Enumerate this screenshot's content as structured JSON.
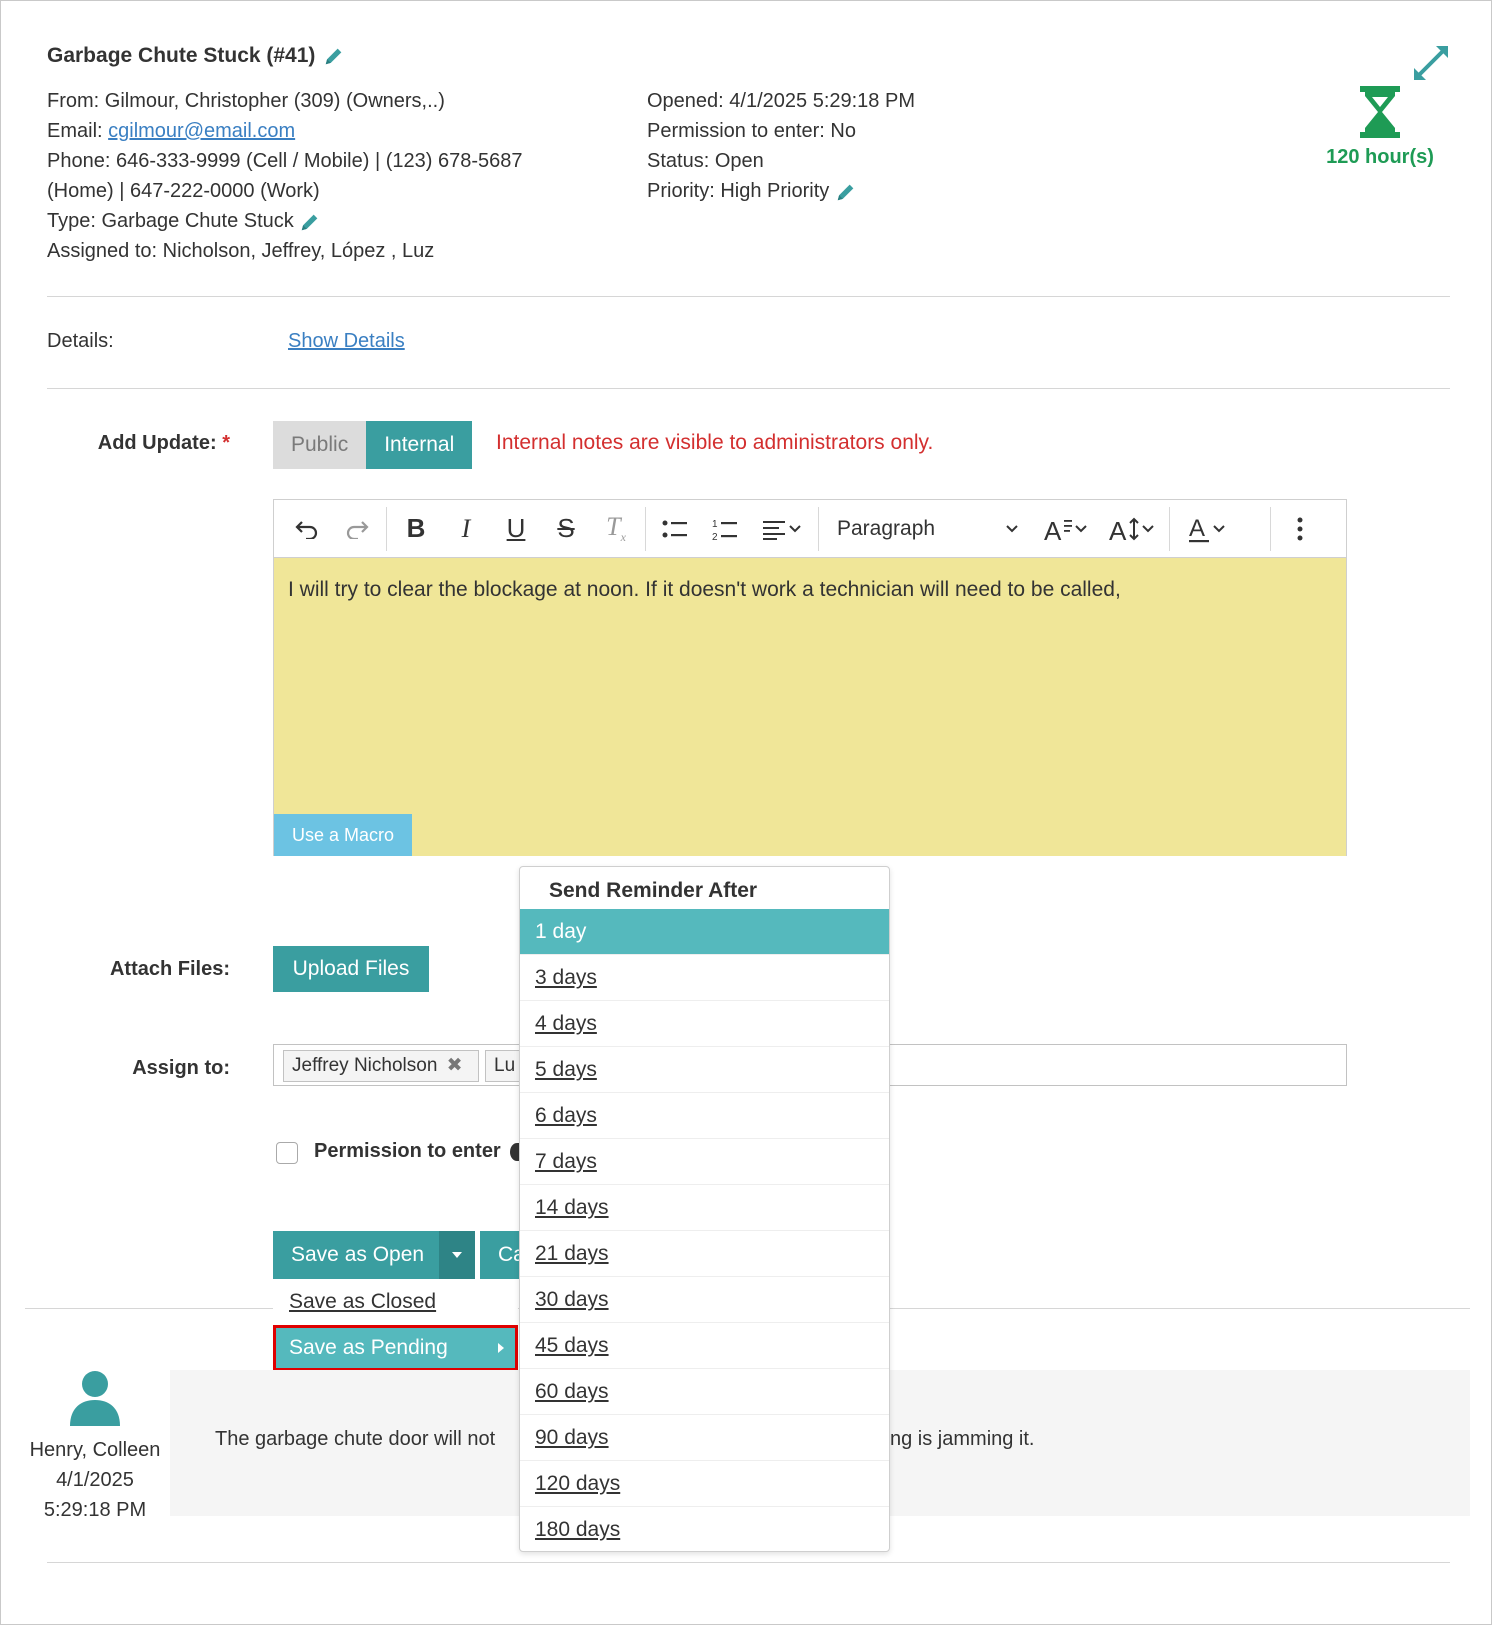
{
  "ticket": {
    "title": "Garbage Chute Stuck (#41)",
    "from": "From: Gilmour, Christopher (309) (Owners,..)",
    "email_label": "Email: ",
    "email": "cgilmour@email.com",
    "phone_line1": "Phone: 646-333-9999 (Cell / Mobile) | (123) 678-5687",
    "phone_line2": "(Home) | 647-222-0000 (Work)",
    "type_label": "Type: Garbage Chute Stuck",
    "assigned": "Assigned to: Nicholson, Jeffrey, López , Luz",
    "opened": "Opened: 4/1/2025 5:29:18 PM",
    "permission": "Permission to enter: No",
    "status": "Status: Open",
    "priority": "Priority: High Priority",
    "timer": "120 hour(s)"
  },
  "details": {
    "label": "Details:",
    "link": "Show Details"
  },
  "update": {
    "label": "Add Update:",
    "required": "*",
    "public": "Public",
    "internal": "Internal",
    "warning": "Internal notes are visible to administrators only.",
    "paragraph": "Paragraph",
    "text": "I will try to clear the blockage at noon. If it doesn't work a technician will need to be called,",
    "macro": "Use a Macro"
  },
  "attach": {
    "label": "Attach Files:",
    "button": "Upload Files"
  },
  "assign": {
    "label": "Assign to:",
    "tags": [
      "Jeffrey Nicholson",
      "Lu"
    ]
  },
  "permission_checkbox": "Permission to enter",
  "save": {
    "main": "Save as Open",
    "cancel_partial": "Ca",
    "closed": "Save as Closed",
    "pending": "Save as Pending"
  },
  "reminder": {
    "header": "Send Reminder After",
    "options": [
      "1 day",
      "3 days",
      "4 days",
      "5 days",
      "6 days",
      "7 days",
      "14 days",
      "21 days",
      "30 days",
      "45 days",
      "60 days",
      "90 days",
      "120 days",
      "180 days"
    ]
  },
  "comment": {
    "author": "Henry, Colleen",
    "date": "4/1/2025",
    "time": "5:29:18 PM",
    "text_left": "The garbage chute door will not",
    "text_right": "ng is jamming it."
  },
  "colors": {
    "teal": "#3a9ea0",
    "light_teal": "#55b9bd",
    "editor_bg": "#f0e698",
    "warning": "#d32f2f",
    "timer_green": "#1e9b55"
  }
}
